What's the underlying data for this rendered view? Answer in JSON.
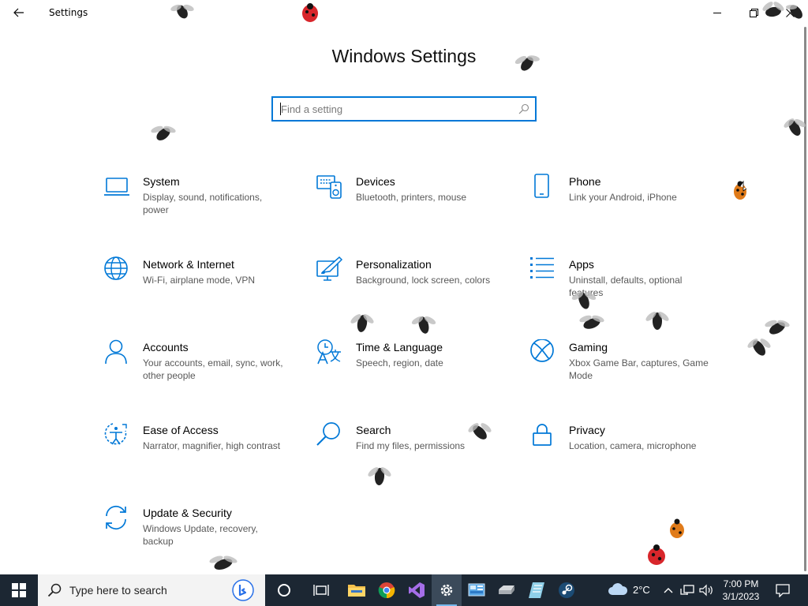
{
  "window": {
    "title": "Settings"
  },
  "page": {
    "heading": "Windows Settings",
    "search_placeholder": "Find a setting"
  },
  "categories": [
    {
      "name": "System",
      "description": "Display, sound, notifications, power",
      "icon": "laptop-icon"
    },
    {
      "name": "Devices",
      "description": "Bluetooth, printers, mouse",
      "icon": "devices-icon"
    },
    {
      "name": "Phone",
      "description": "Link your Android, iPhone",
      "icon": "phone-icon"
    },
    {
      "name": "Network & Internet",
      "description": "Wi-Fi, airplane mode, VPN",
      "icon": "globe-icon"
    },
    {
      "name": "Personalization",
      "description": "Background, lock screen, colors",
      "icon": "personalization-icon"
    },
    {
      "name": "Apps",
      "description": "Uninstall, defaults, optional features",
      "icon": "apps-list-icon"
    },
    {
      "name": "Accounts",
      "description": "Your accounts, email, sync, work, other people",
      "icon": "person-icon"
    },
    {
      "name": "Time & Language",
      "description": "Speech, region, date",
      "icon": "time-language-icon"
    },
    {
      "name": "Gaming",
      "description": "Xbox Game Bar, captures, Game Mode",
      "icon": "xbox-icon"
    },
    {
      "name": "Ease of Access",
      "description": "Narrator, magnifier, high contrast",
      "icon": "ease-of-access-icon"
    },
    {
      "name": "Search",
      "description": "Find my files, permissions",
      "icon": "magnifier-icon"
    },
    {
      "name": "Privacy",
      "description": "Location, camera, microphone",
      "icon": "lock-icon"
    },
    {
      "name": "Update & Security",
      "description": "Windows Update, recovery, backup",
      "icon": "sync-arrows-icon"
    }
  ],
  "taskbar": {
    "search_text": "Type here to search",
    "apps": [
      {
        "name": "Cortana",
        "icon": "cortana-icon"
      },
      {
        "name": "Task View",
        "icon": "task-view-icon"
      },
      {
        "name": "File Explorer",
        "icon": "folder-icon"
      },
      {
        "name": "Google Chrome",
        "icon": "chrome-icon"
      },
      {
        "name": "Visual Studio",
        "icon": "visual-studio-icon"
      },
      {
        "name": "Settings",
        "icon": "gear-icon",
        "active": true
      },
      {
        "name": "Control Panel",
        "icon": "control-panel-icon"
      },
      {
        "name": "Drive",
        "icon": "drive-icon"
      },
      {
        "name": "Notepad",
        "icon": "notepad-icon"
      },
      {
        "name": "Steam",
        "icon": "steam-icon"
      }
    ],
    "weather": {
      "temperature": "2°C",
      "icon": "cloud-icon"
    },
    "clock": {
      "time": "7:00 PM",
      "date": "3/1/2023"
    }
  },
  "colors": {
    "accent": "#0078d7",
    "taskbar": "#1c2733",
    "description_text": "#595959"
  }
}
